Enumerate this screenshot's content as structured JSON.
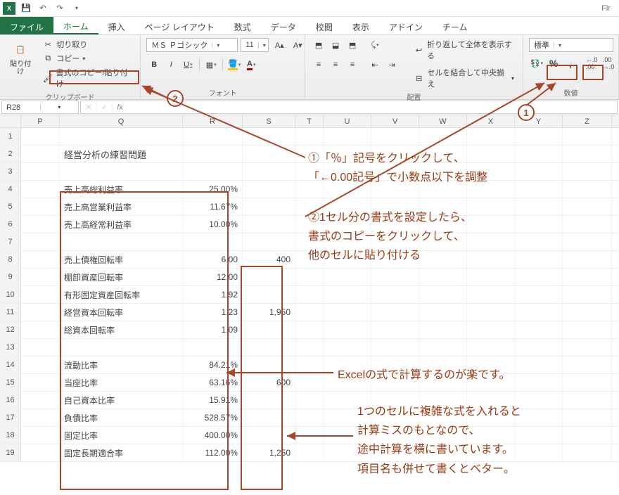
{
  "app": {
    "title_right": "Fir"
  },
  "qat": {
    "save": "save-icon",
    "undo": "undo-icon",
    "redo": "redo-icon"
  },
  "tabs": {
    "file": "ファイル",
    "items": [
      "ホーム",
      "挿入",
      "ページ レイアウト",
      "数式",
      "データ",
      "校閲",
      "表示",
      "アドイン",
      "チーム"
    ],
    "active_index": 0
  },
  "ribbon": {
    "clipboard": {
      "paste": "貼り付け",
      "cut": "切り取り",
      "copy": "コピー",
      "format_painter": "書式のコピー/貼り付け",
      "label": "クリップボード"
    },
    "font": {
      "font_name": "ＭＳ Ｐゴシック",
      "font_size": "11",
      "label": "フォント",
      "bold": "B",
      "italic": "I",
      "underline": "U"
    },
    "alignment": {
      "wrap": "折り返して全体を表示する",
      "merge": "セルを結合して中央揃え",
      "label": "配置"
    },
    "number": {
      "format": "標準",
      "percent": "%",
      "comma": ",",
      "inc_dec_left": "←0.0",
      "inc_dec_right": ".00→",
      "label": "数値"
    }
  },
  "namebox": "R28",
  "columns": [
    "P",
    "Q",
    "R",
    "S",
    "T",
    "U",
    "V",
    "W",
    "X",
    "Y",
    "Z"
  ],
  "sheet_title": "経営分析の練習問題",
  "rows": [
    {
      "n": 1
    },
    {
      "n": 2,
      "Q": "経営分析の練習問題"
    },
    {
      "n": 3
    },
    {
      "n": 4,
      "Q": "売上高総利益率",
      "R": "25.00%"
    },
    {
      "n": 5,
      "Q": "売上高営業利益率",
      "R": "11.67%"
    },
    {
      "n": 6,
      "Q": "売上高経常利益率",
      "R": "10.00%"
    },
    {
      "n": 7
    },
    {
      "n": 8,
      "Q": "売上債権回転率",
      "R": "6.00",
      "S": "400"
    },
    {
      "n": 9,
      "Q": "棚卸資産回転率",
      "R": "12.00"
    },
    {
      "n": 10,
      "Q": "有形固定資産回転率",
      "R": "1.92"
    },
    {
      "n": 11,
      "Q": "経営資本回転率",
      "R": "1.23",
      "S": "1,950"
    },
    {
      "n": 12,
      "Q": "総資本回転率",
      "R": "1.09"
    },
    {
      "n": 13
    },
    {
      "n": 14,
      "Q": "流動比率",
      "R": "84.21%"
    },
    {
      "n": 15,
      "Q": "当座比率",
      "R": "63.16%",
      "S": "600"
    },
    {
      "n": 16,
      "Q": "自己資本比率",
      "R": "15.91%"
    },
    {
      "n": 17,
      "Q": "負債比率",
      "R": "528.57%"
    },
    {
      "n": 18,
      "Q": "固定比率",
      "R": "400.00%"
    },
    {
      "n": 19,
      "Q": "固定長期適合率",
      "R": "112.00%",
      "S": "1,250"
    }
  ],
  "annotations": {
    "step1_a": "①「％」記号をクリックして、",
    "step1_b": "「←0.00記号」で小数点以下を調整",
    "step2_a": "②1セル分の書式を設定したら、",
    "step2_b": "書式のコピーをクリックして、",
    "step2_c": "他のセルに貼り付ける",
    "step3": "Excelの式で計算するのが楽です。",
    "step4_a": "1つのセルに複雑な式を入れると",
    "step4_b": "計算ミスのもとなので、",
    "step4_c": "途中計算を横に書いています。",
    "step4_d": "項目名も併せて書くとベター。",
    "badge1": "1",
    "badge2": "2"
  }
}
